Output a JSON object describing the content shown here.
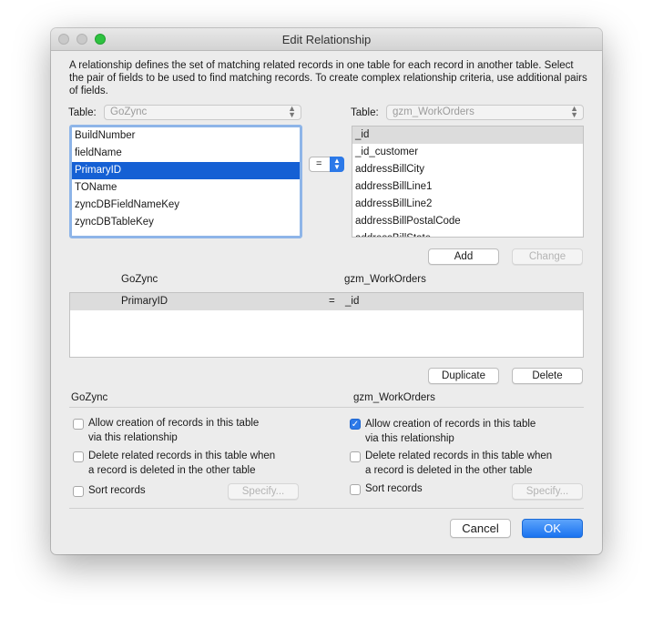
{
  "window": {
    "title": "Edit Relationship"
  },
  "description": "A relationship defines the set of matching related records in one table for each record in another table. Select the pair of fields to be used to find matching records. To create complex relationship criteria, use additional pairs of fields.",
  "left_table": {
    "label": "Table:",
    "selected": "GoZync",
    "fields": [
      "BuildNumber",
      "fieldName",
      "PrimaryID",
      "TOName",
      "zyncDBFieldNameKey",
      "zyncDBTableKey"
    ],
    "selected_field": "PrimaryID"
  },
  "operator": {
    "value": "="
  },
  "right_table": {
    "label": "Table:",
    "selected": "gzm_WorkOrders",
    "fields": [
      "_id",
      "_id_customer",
      "addressBillCity",
      "addressBillLine1",
      "addressBillLine2",
      "addressBillPostalCode",
      "addressBillState"
    ],
    "selected_field": "_id"
  },
  "buttons": {
    "add": "Add",
    "change": "Change",
    "duplicate": "Duplicate",
    "delete": "Delete",
    "cancel": "Cancel",
    "ok": "OK",
    "specify": "Specify..."
  },
  "relations": {
    "left_header": "GoZync",
    "right_header": "gzm_WorkOrders",
    "rows": [
      {
        "left": "PrimaryID",
        "op": "=",
        "right": "_id"
      }
    ]
  },
  "options_left": {
    "title": "GoZync",
    "allow_creation": "Allow creation of records in this table",
    "allow_creation_2": "via this relationship",
    "allow_creation_checked": false,
    "delete_related": "Delete related records in this table when",
    "delete_related_2": "a record is deleted in the other table",
    "delete_related_checked": false,
    "sort": "Sort records",
    "sort_checked": false
  },
  "options_right": {
    "title": "gzm_WorkOrders",
    "allow_creation": "Allow creation of records in this table",
    "allow_creation_2": "via this relationship",
    "allow_creation_checked": true,
    "delete_related": "Delete related records in this table when",
    "delete_related_2": "a record is deleted in the other table",
    "delete_related_checked": false,
    "sort": "Sort records",
    "sort_checked": false
  },
  "colors": {
    "accent": "#1560d4",
    "focus_ring": "#8eb5e8"
  }
}
